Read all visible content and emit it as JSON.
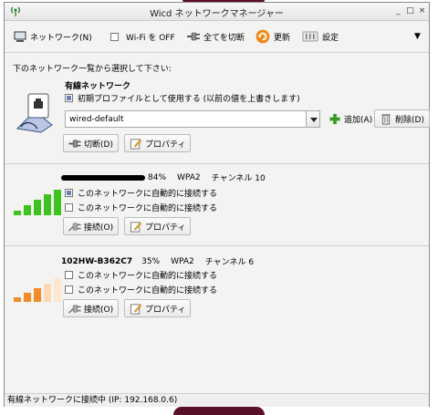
{
  "window": {
    "title": "Wicd ネットワークマネージャー",
    "min": "_",
    "max": "□",
    "close": "×"
  },
  "toolbar": {
    "network": "ネットワーク(N)",
    "wifi_off": "Wi-Fi を OFF",
    "disconnect_all": "全てを切断",
    "refresh": "更新",
    "preferences": "設定",
    "menu_arrow": "▼"
  },
  "instruction": "下のネットワーク一覧から選択して下さい:",
  "wired": {
    "title": "有線ネットワーク",
    "default_profile": "初期プロファイルとして使用する (以前の値を上書きします)",
    "profile_value": "wired-default",
    "add": "追加(A)",
    "delete": "削除(D)",
    "disconnect": "切断(D)",
    "properties": "プロパティ"
  },
  "networks": [
    {
      "ssid": "",
      "strength": "84%",
      "security": "WPA2",
      "channel": "チャンネル 10",
      "auto_connect_checked": "このネットワークに自動的に接続する",
      "auto_connect": "このネットワークに自動的に接続する",
      "connect": "接続(O)",
      "properties": "プロパティ",
      "signal_color": "#3fc11f"
    },
    {
      "ssid": "102HW-B362C7",
      "strength": "35%",
      "security": "WPA2",
      "channel": "チャンネル 6",
      "auto_connect_1": "このネットワークに自動的に接続する",
      "auto_connect_2": "このネットワークに自動的に接続する",
      "connect": "接続(O)",
      "properties": "プロパティ",
      "signal_color": "#f08c2a"
    }
  ],
  "status": "有線ネットワークに接続中 (IP: 192.168.0.6)",
  "icons": [
    "wicd-icon",
    "network-icon",
    "plug-icon",
    "refresh-icon",
    "gear-icon",
    "wired-icon",
    "add-icon",
    "trash-icon",
    "edit-icon",
    "signal-icon"
  ]
}
